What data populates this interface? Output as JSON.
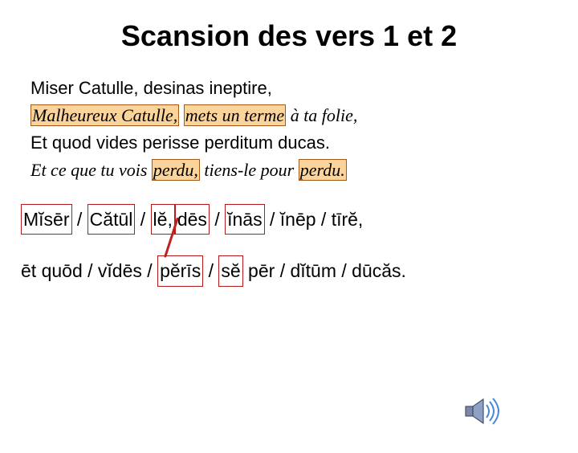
{
  "title": "Scansion des vers 1 et 2",
  "lines": {
    "latin1": "Miser Catulle, desinas ineptire,",
    "fr1_a": "Malheureux Catulle,",
    "fr1_b": "mets un terme",
    "fr1_c": " à ta folie,",
    "latin2": "Et quod vides perisse perditum ducas.",
    "fr2_a": "Et ce que tu vois ",
    "fr2_b": "perdu,",
    "fr2_c": " tiens-le pour ",
    "fr2_d": "perdu.",
    "scan1_a": "Mĭsēr",
    "slash1": " / ",
    "scan1_b": "Cătūl",
    "slash2": " / ",
    "scan1_c": "lĕ,",
    "scan1_d": " dēs",
    "slash3": " / ",
    "scan1_e": "ĭnās",
    "scan1_rest": " / ĭnēp / tīrĕ,",
    "scan2_a": "ēt quōd / vĭdēs / ",
    "scan2_b": "pĕrīs",
    "scan2_c": " / ",
    "scan2_d": "sĕ",
    "scan2_rest": " pēr / dĭtūm / dūcăs."
  }
}
